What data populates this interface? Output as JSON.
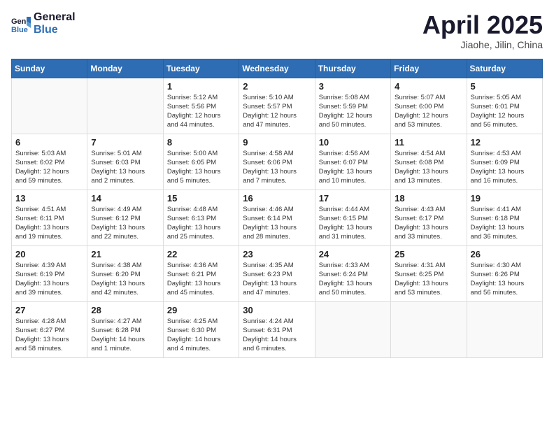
{
  "header": {
    "logo_general": "General",
    "logo_blue": "Blue",
    "title": "April 2025",
    "location": "Jiaohe, Jilin, China"
  },
  "weekdays": [
    "Sunday",
    "Monday",
    "Tuesday",
    "Wednesday",
    "Thursday",
    "Friday",
    "Saturday"
  ],
  "weeks": [
    [
      {
        "day": "",
        "info": ""
      },
      {
        "day": "",
        "info": ""
      },
      {
        "day": "1",
        "info": "Sunrise: 5:12 AM\nSunset: 5:56 PM\nDaylight: 12 hours\nand 44 minutes."
      },
      {
        "day": "2",
        "info": "Sunrise: 5:10 AM\nSunset: 5:57 PM\nDaylight: 12 hours\nand 47 minutes."
      },
      {
        "day": "3",
        "info": "Sunrise: 5:08 AM\nSunset: 5:59 PM\nDaylight: 12 hours\nand 50 minutes."
      },
      {
        "day": "4",
        "info": "Sunrise: 5:07 AM\nSunset: 6:00 PM\nDaylight: 12 hours\nand 53 minutes."
      },
      {
        "day": "5",
        "info": "Sunrise: 5:05 AM\nSunset: 6:01 PM\nDaylight: 12 hours\nand 56 minutes."
      }
    ],
    [
      {
        "day": "6",
        "info": "Sunrise: 5:03 AM\nSunset: 6:02 PM\nDaylight: 12 hours\nand 59 minutes."
      },
      {
        "day": "7",
        "info": "Sunrise: 5:01 AM\nSunset: 6:03 PM\nDaylight: 13 hours\nand 2 minutes."
      },
      {
        "day": "8",
        "info": "Sunrise: 5:00 AM\nSunset: 6:05 PM\nDaylight: 13 hours\nand 5 minutes."
      },
      {
        "day": "9",
        "info": "Sunrise: 4:58 AM\nSunset: 6:06 PM\nDaylight: 13 hours\nand 7 minutes."
      },
      {
        "day": "10",
        "info": "Sunrise: 4:56 AM\nSunset: 6:07 PM\nDaylight: 13 hours\nand 10 minutes."
      },
      {
        "day": "11",
        "info": "Sunrise: 4:54 AM\nSunset: 6:08 PM\nDaylight: 13 hours\nand 13 minutes."
      },
      {
        "day": "12",
        "info": "Sunrise: 4:53 AM\nSunset: 6:09 PM\nDaylight: 13 hours\nand 16 minutes."
      }
    ],
    [
      {
        "day": "13",
        "info": "Sunrise: 4:51 AM\nSunset: 6:11 PM\nDaylight: 13 hours\nand 19 minutes."
      },
      {
        "day": "14",
        "info": "Sunrise: 4:49 AM\nSunset: 6:12 PM\nDaylight: 13 hours\nand 22 minutes."
      },
      {
        "day": "15",
        "info": "Sunrise: 4:48 AM\nSunset: 6:13 PM\nDaylight: 13 hours\nand 25 minutes."
      },
      {
        "day": "16",
        "info": "Sunrise: 4:46 AM\nSunset: 6:14 PM\nDaylight: 13 hours\nand 28 minutes."
      },
      {
        "day": "17",
        "info": "Sunrise: 4:44 AM\nSunset: 6:15 PM\nDaylight: 13 hours\nand 31 minutes."
      },
      {
        "day": "18",
        "info": "Sunrise: 4:43 AM\nSunset: 6:17 PM\nDaylight: 13 hours\nand 33 minutes."
      },
      {
        "day": "19",
        "info": "Sunrise: 4:41 AM\nSunset: 6:18 PM\nDaylight: 13 hours\nand 36 minutes."
      }
    ],
    [
      {
        "day": "20",
        "info": "Sunrise: 4:39 AM\nSunset: 6:19 PM\nDaylight: 13 hours\nand 39 minutes."
      },
      {
        "day": "21",
        "info": "Sunrise: 4:38 AM\nSunset: 6:20 PM\nDaylight: 13 hours\nand 42 minutes."
      },
      {
        "day": "22",
        "info": "Sunrise: 4:36 AM\nSunset: 6:21 PM\nDaylight: 13 hours\nand 45 minutes."
      },
      {
        "day": "23",
        "info": "Sunrise: 4:35 AM\nSunset: 6:23 PM\nDaylight: 13 hours\nand 47 minutes."
      },
      {
        "day": "24",
        "info": "Sunrise: 4:33 AM\nSunset: 6:24 PM\nDaylight: 13 hours\nand 50 minutes."
      },
      {
        "day": "25",
        "info": "Sunrise: 4:31 AM\nSunset: 6:25 PM\nDaylight: 13 hours\nand 53 minutes."
      },
      {
        "day": "26",
        "info": "Sunrise: 4:30 AM\nSunset: 6:26 PM\nDaylight: 13 hours\nand 56 minutes."
      }
    ],
    [
      {
        "day": "27",
        "info": "Sunrise: 4:28 AM\nSunset: 6:27 PM\nDaylight: 13 hours\nand 58 minutes."
      },
      {
        "day": "28",
        "info": "Sunrise: 4:27 AM\nSunset: 6:28 PM\nDaylight: 14 hours\nand 1 minute."
      },
      {
        "day": "29",
        "info": "Sunrise: 4:25 AM\nSunset: 6:30 PM\nDaylight: 14 hours\nand 4 minutes."
      },
      {
        "day": "30",
        "info": "Sunrise: 4:24 AM\nSunset: 6:31 PM\nDaylight: 14 hours\nand 6 minutes."
      },
      {
        "day": "",
        "info": ""
      },
      {
        "day": "",
        "info": ""
      },
      {
        "day": "",
        "info": ""
      }
    ]
  ]
}
